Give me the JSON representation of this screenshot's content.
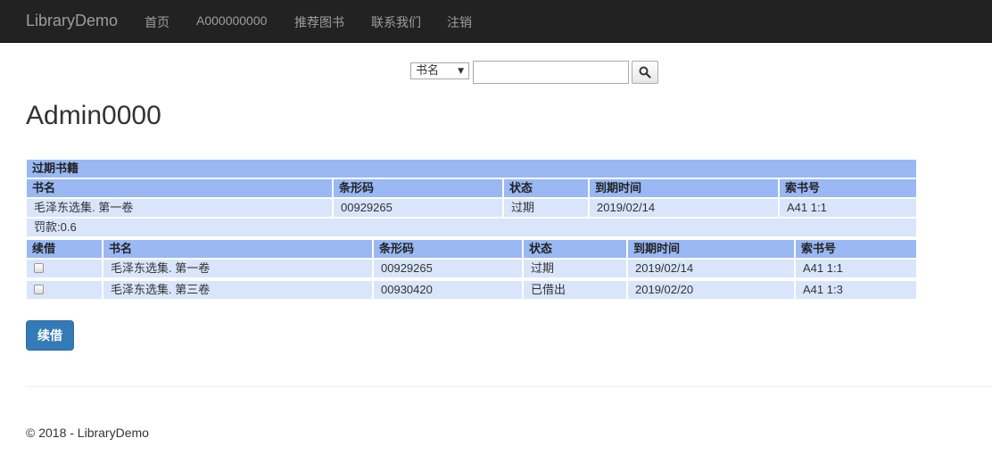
{
  "nav": {
    "brand": "LibraryDemo",
    "links": [
      "首页",
      "A000000000",
      "推荐图书",
      "联系我们",
      "注销"
    ]
  },
  "search": {
    "field_selected": "书名",
    "input_value": ""
  },
  "page": {
    "title": "Admin0000"
  },
  "overdue": {
    "caption": "过期书籍",
    "headers": [
      "书名",
      "条形码",
      "状态",
      "到期时间",
      "索书号"
    ],
    "rows": [
      [
        "毛泽东选集. 第一卷",
        "00929265",
        "过期",
        "2019/02/14",
        "A41 1:1"
      ]
    ],
    "fine": "罚款:0.6"
  },
  "borrowed": {
    "headers": [
      "续借",
      "书名",
      "条形码",
      "状态",
      "到期时间",
      "索书号"
    ],
    "rows": [
      [
        "毛泽东选集. 第一卷",
        "00929265",
        "过期",
        "2019/02/14",
        "A41 1:1"
      ],
      [
        "毛泽东选集. 第三卷",
        "00930420",
        "已借出",
        "2019/02/20",
        "A41 1:3"
      ]
    ]
  },
  "actions": {
    "renew_label": "续借"
  },
  "footer": {
    "text": "© 2018 - LibraryDemo"
  },
  "colors": {
    "navbar": "#222222",
    "header_row": "#99b8f4",
    "data_row": "#d9e5fb",
    "primary": "#337ab7"
  },
  "icons": {
    "search": "search-icon",
    "dropdown": "chevron-down-icon"
  }
}
